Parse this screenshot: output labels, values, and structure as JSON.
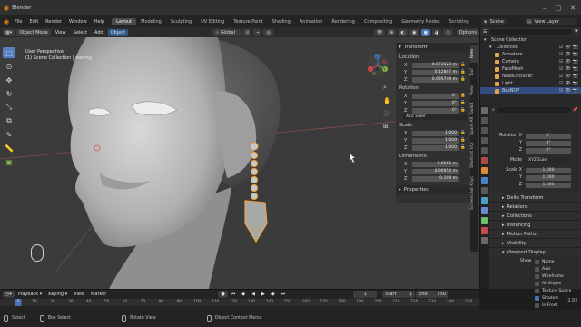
{
  "window": {
    "title": "Blender"
  },
  "menu": {
    "items": [
      "File",
      "Edit",
      "Render",
      "Window",
      "Help"
    ]
  },
  "workspaces": [
    "Layout",
    "Modeling",
    "Sculpting",
    "UV Editing",
    "Texture Paint",
    "Shading",
    "Animation",
    "Rendering",
    "Compositing",
    "Geometry Nodes",
    "Scripting"
  ],
  "scene": {
    "name": "Scene",
    "view_layer": "View Layer"
  },
  "viewport_header": {
    "mode": "Object Mode",
    "menus": [
      "View",
      "Select",
      "Add",
      "Object"
    ],
    "transform_orientation": "Global",
    "options": "Options"
  },
  "viewport": {
    "perspective": "User Perspective",
    "collection_info": "(1) Scene Collection | earring",
    "gizmo_axes": [
      "X",
      "Y",
      "Z"
    ]
  },
  "n_panel": {
    "transform_header": "Transform",
    "location_label": "Location:",
    "location": [
      {
        "axis": "X",
        "value": "0.073123 m"
      },
      {
        "axis": "Y",
        "value": "0.12807 m"
      },
      {
        "axis": "Z",
        "value": "0.095749 m"
      }
    ],
    "rotation_label": "Rotation:",
    "rotation": [
      {
        "axis": "X",
        "value": "0°"
      },
      {
        "axis": "Y",
        "value": "0°"
      },
      {
        "axis": "Z",
        "value": "0°"
      }
    ],
    "rotation_mode": "XYZ Euler",
    "scale_label": "Scale:",
    "scale": [
      {
        "axis": "X",
        "value": "1.000"
      },
      {
        "axis": "Y",
        "value": "1.000"
      },
      {
        "axis": "Z",
        "value": "1.000"
      }
    ],
    "dimensions_label": "Dimensions:",
    "dimensions": [
      {
        "axis": "X",
        "value": "0.0261 m"
      },
      {
        "axis": "Y",
        "value": "0.00954 m"
      },
      {
        "axis": "Z",
        "value": "0.109 m"
      }
    ],
    "properties_header": "Properties",
    "tabs": [
      "Item",
      "Tool",
      "View",
      "Spark AR Toolkit",
      "Shortcut VUr",
      "Screencast Keys"
    ]
  },
  "outliner": {
    "rows": [
      {
        "label": "Scene Collection",
        "indent": 0,
        "color": "#e0e0e0",
        "selected": false
      },
      {
        "label": "Collection",
        "indent": 1,
        "color": "#e0e0e0",
        "selected": false
      },
      {
        "label": "Armature",
        "indent": 2,
        "color": "#e5a14b",
        "selected": false
      },
      {
        "label": "Camera",
        "indent": 2,
        "color": "#e5a14b",
        "selected": false
      },
      {
        "label": "FaceMesh",
        "indent": 2,
        "color": "#e5a14b",
        "selected": false
      },
      {
        "label": "headOccluder",
        "indent": 2,
        "color": "#e5a14b",
        "selected": false
      },
      {
        "label": "Light",
        "indent": 2,
        "color": "#e5a14b",
        "selected": false
      },
      {
        "label": "BezNOP",
        "indent": 2,
        "color": "#e5a14b",
        "selected": true
      }
    ]
  },
  "properties": {
    "rotation": [
      {
        "label": "Rotation X",
        "value": "0°"
      },
      {
        "label": "Y",
        "value": "0°"
      },
      {
        "label": "Z",
        "value": "0°"
      }
    ],
    "mode_label": "Mode",
    "mode": "XYZ Euler",
    "scale": [
      {
        "label": "Scale X",
        "value": "1.000"
      },
      {
        "label": "Y",
        "value": "1.000"
      },
      {
        "label": "Z",
        "value": "1.000"
      }
    ],
    "sections": [
      "Delta Transform",
      "Relations",
      "Collections",
      "Instancing",
      "Motion Paths",
      "Visibility",
      "Viewport Display"
    ],
    "show_label": "Show",
    "show_options": [
      {
        "label": "Name",
        "checked": false
      },
      {
        "label": "Axis",
        "checked": false
      },
      {
        "label": "Wireframe",
        "checked": false
      },
      {
        "label": "All Edges",
        "checked": false
      },
      {
        "label": "Texture Space",
        "checked": false
      },
      {
        "label": "Shadow",
        "checked": true
      },
      {
        "label": "In Front",
        "checked": false
      }
    ]
  },
  "timeline": {
    "menus": [
      "Playback",
      "Keying",
      "View",
      "Marker"
    ],
    "current_frame": "1",
    "start_label": "Start",
    "start": "1",
    "end_label": "End",
    "end": "250",
    "ruler_ticks": [
      "0",
      "10",
      "20",
      "30",
      "40",
      "50",
      "60",
      "70",
      "80",
      "90",
      "100",
      "110",
      "120",
      "130",
      "140",
      "150",
      "160",
      "170",
      "180",
      "190",
      "200",
      "210",
      "220",
      "230",
      "240",
      "250"
    ],
    "playhead": "1"
  },
  "statusbar": {
    "items": [
      "Select",
      "Box Select",
      "Rotate View",
      "Object Context Menu"
    ],
    "version": "2.93"
  },
  "colors": {
    "accent": "#4772b3",
    "selection_outline": "#f0a13a",
    "background": "#3b3b3b"
  }
}
